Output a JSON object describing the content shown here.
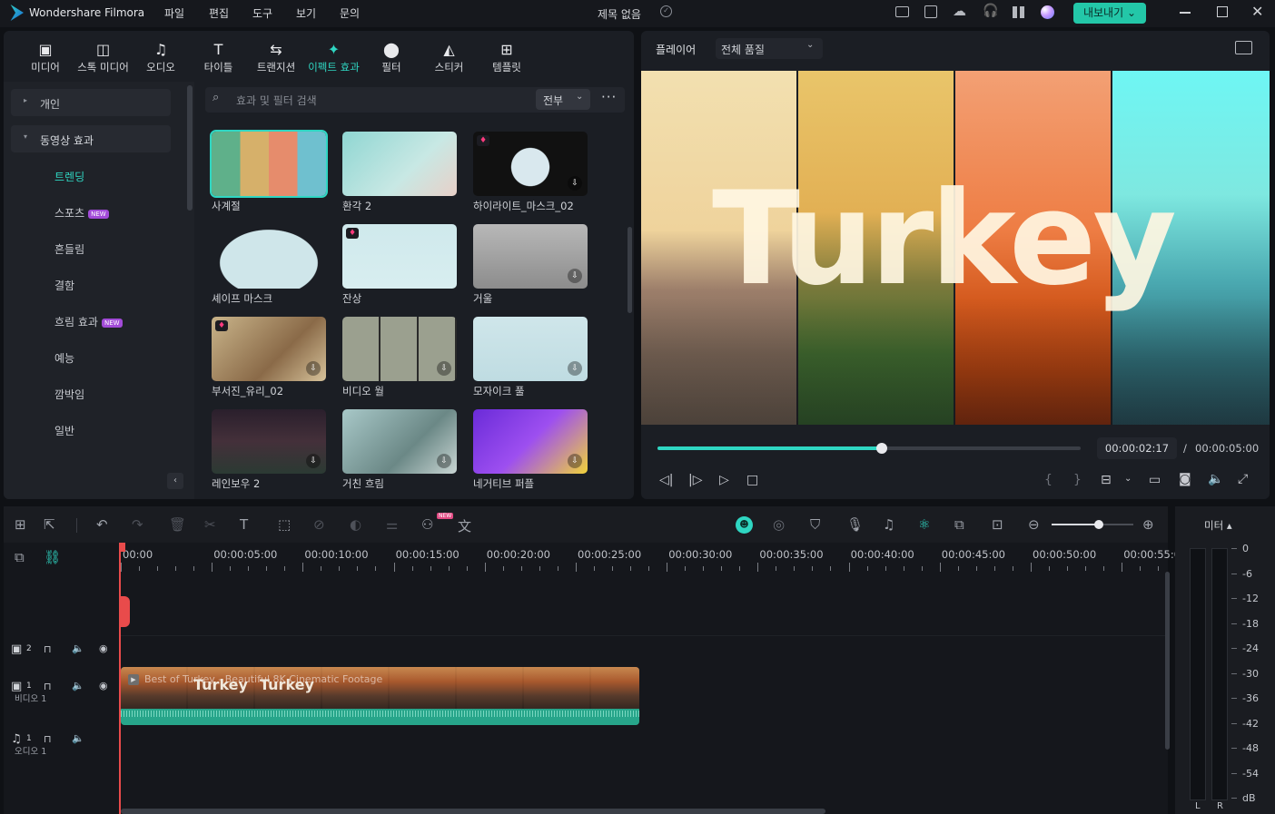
{
  "app": {
    "name": "Wondershare Filmora",
    "project_title": "제목 없음",
    "export_label": "내보내기"
  },
  "menu": [
    "파일",
    "편집",
    "도구",
    "보기",
    "문의"
  ],
  "toolbar": [
    {
      "label": "미디어",
      "icon": "media-icon"
    },
    {
      "label": "스톡 미디어",
      "icon": "stock-media-icon"
    },
    {
      "label": "오디오",
      "icon": "audio-icon"
    },
    {
      "label": "타이틀",
      "icon": "titles-icon"
    },
    {
      "label": "트랜지션",
      "icon": "transition-icon"
    },
    {
      "label": "이펙트 효과",
      "icon": "effects-icon",
      "active": true
    },
    {
      "label": "필터",
      "icon": "filter-icon"
    },
    {
      "label": "스티커",
      "icon": "sticker-icon"
    },
    {
      "label": "템플릿",
      "icon": "template-icon"
    }
  ],
  "sidebar": {
    "personal": "개인",
    "video_effects": "동영상 효과",
    "items": [
      {
        "label": "트렌딩",
        "active": true
      },
      {
        "label": "스포츠",
        "new": true
      },
      {
        "label": "흔들림"
      },
      {
        "label": "결함"
      },
      {
        "label": "흐림 효과",
        "new": true
      },
      {
        "label": "예능"
      },
      {
        "label": "깜박임"
      },
      {
        "label": "일반"
      }
    ],
    "new_badge": "NEW"
  },
  "search": {
    "placeholder": "효과 및 필터 검색",
    "filter": "전부"
  },
  "effects": [
    {
      "label": "사계절"
    },
    {
      "label": "환각 2"
    },
    {
      "label": "하이라이트_마스크_02"
    },
    {
      "label": "셰이프 마스크"
    },
    {
      "label": "잔상"
    },
    {
      "label": "거울"
    },
    {
      "label": "부서진_유리_02"
    },
    {
      "label": "비디오 월"
    },
    {
      "label": "모자이크 풀"
    },
    {
      "label": "레인보우 2"
    },
    {
      "label": "거친 흐림"
    },
    {
      "label": "네거티브 퍼플"
    }
  ],
  "player": {
    "tab": "플레이어",
    "quality": "전체 품질",
    "preview_text": "Turkey",
    "current_time": "00:00:02:17",
    "separator": "/",
    "total_time": "00:00:05:00",
    "progress": 0.53
  },
  "timeline": {
    "ticks": [
      "00:00",
      "00:00:05:00",
      "00:00:10:00",
      "00:00:15:00",
      "00:00:20:00",
      "00:00:25:00",
      "00:00:30:00",
      "00:00:35:00",
      "00:00:40:00",
      "00:00:45:00",
      "00:00:50:00",
      "00:00:55:00"
    ],
    "tracks": [
      {
        "num": "2",
        "name": ""
      },
      {
        "num": "1",
        "name": "비디오 1"
      },
      {
        "num": "1",
        "name": "오디오 1"
      }
    ],
    "clip_title": "Best of Turkey - Beautiful 8K Cinematic Footage",
    "clip_text": [
      "Turkey",
      "Turkey"
    ],
    "zoom": 0.58
  },
  "meter": {
    "label": "미터",
    "levels": [
      "0",
      "-6",
      "-12",
      "-18",
      "-24",
      "-30",
      "-36",
      "-42",
      "-48",
      "-54",
      "dB"
    ],
    "channels": [
      "L",
      "R"
    ]
  },
  "colors": {
    "accent": "#2fd6c2",
    "bg": "#0f1115",
    "panel": "#1b1e24",
    "playhead": "#e94b4b",
    "export": "#23c7a8"
  }
}
